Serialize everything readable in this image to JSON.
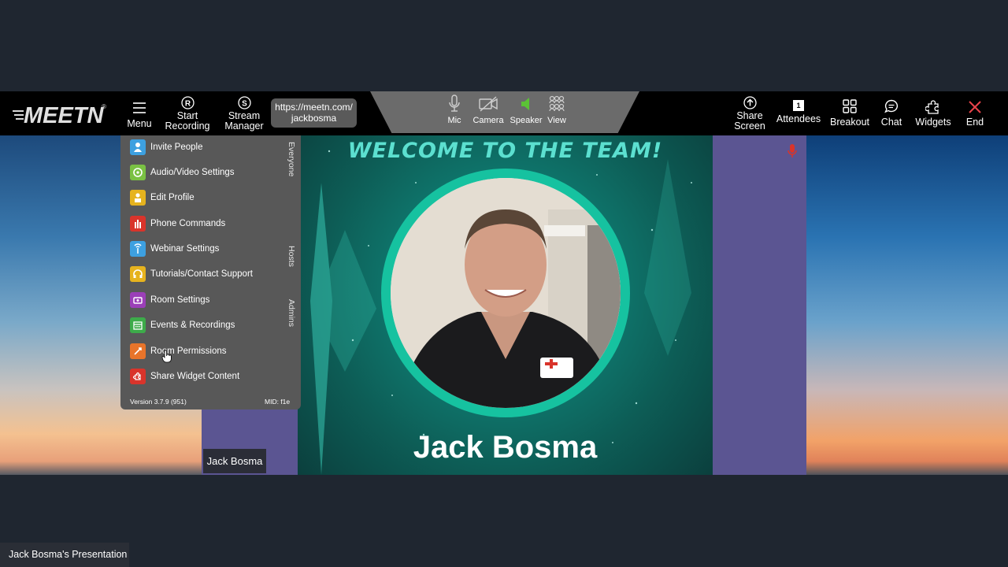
{
  "toolbar": {
    "logo_text": "MEETN",
    "menu": "Menu",
    "start_recording_line1": "Start",
    "start_recording_line2": "Recording",
    "stream_manager_line1": "Stream",
    "stream_manager_line2": "Manager",
    "url_line1": "https://meetn.com/",
    "url_line2": "jackbosma",
    "mic": "Mic",
    "camera": "Camera",
    "speaker": "Speaker",
    "view": "View",
    "share_screen_line1": "Share",
    "share_screen_line2": "Screen",
    "attendees": "Attendees",
    "attendee_count": "1",
    "breakout": "Breakout",
    "chat": "Chat",
    "widgets": "Widgets",
    "end": "End"
  },
  "menu": {
    "items": [
      {
        "label": "Invite People",
        "icon": "person-icon",
        "color": "#3da0e0"
      },
      {
        "label": "Audio/Video Settings",
        "icon": "av-settings-icon",
        "color": "#7ac143"
      },
      {
        "label": "Edit Profile",
        "icon": "edit-profile-icon",
        "color": "#e6b31e"
      },
      {
        "label": "Phone Commands",
        "icon": "phone-commands-icon",
        "color": "#d9342b"
      },
      {
        "label": "Webinar Settings",
        "icon": "webinar-icon",
        "color": "#3da0e0"
      },
      {
        "label": "Tutorials/Contact Support",
        "icon": "support-icon",
        "color": "#e6b31e"
      },
      {
        "label": "Room Settings",
        "icon": "room-settings-icon",
        "color": "#9b3fb8"
      },
      {
        "label": "Events & Recordings",
        "icon": "calendar-icon",
        "color": "#3dab4a"
      },
      {
        "label": "Room Permissions",
        "icon": "permissions-icon",
        "color": "#e8742a"
      },
      {
        "label": "Share Widget Content",
        "icon": "share-widget-icon",
        "color": "#d9342b"
      }
    ],
    "section_everyone": "Everyone",
    "section_hosts": "Hosts",
    "section_admins": "Admins",
    "version": "Version 3.7.9 (951)",
    "mid": "MID: f1e"
  },
  "video": {
    "welcome_text": "WELCOME TO THE TEAM!",
    "presenter_name": "Jack Bosma"
  },
  "name_tag": "Jack Bosma",
  "presentation_caption": "Jack Bosma's Presentation"
}
